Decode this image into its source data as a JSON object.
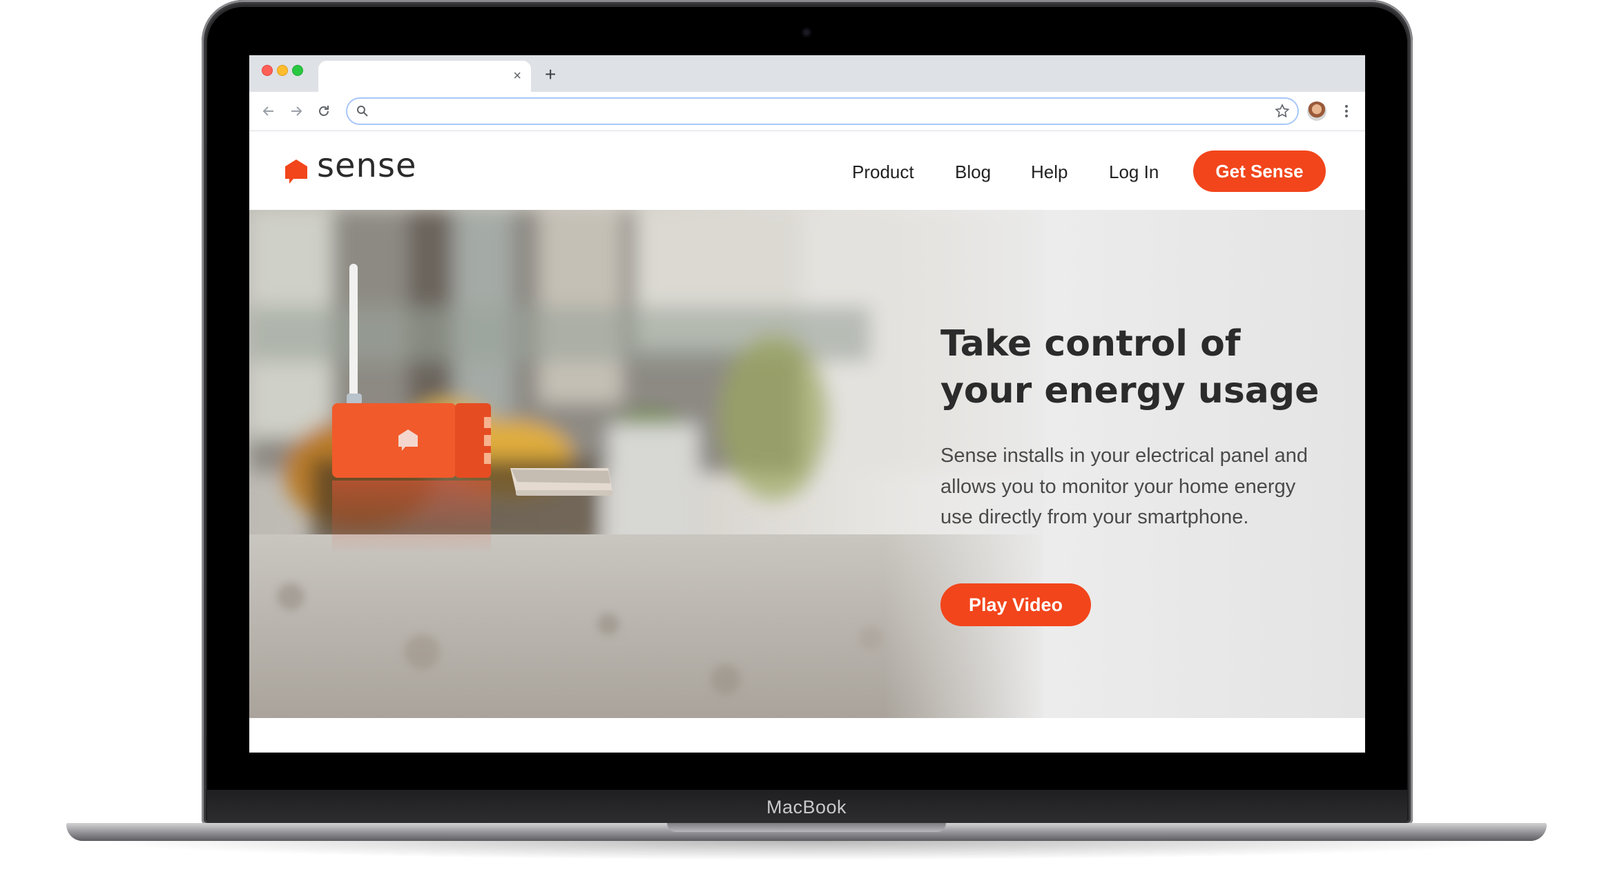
{
  "device": {
    "brand_label": "MacBook"
  },
  "browser": {
    "tab_close_glyph": "×",
    "new_tab_glyph": "+",
    "address_value": "",
    "icons": [
      "back-icon",
      "forward-icon",
      "reload-icon",
      "search-icon",
      "star-icon",
      "profile-avatar",
      "more-menu-icon"
    ]
  },
  "site": {
    "logo_text": "sense",
    "nav": {
      "product": "Product",
      "blog": "Blog",
      "help": "Help",
      "login": "Log In"
    },
    "cta_label": "Get Sense"
  },
  "hero": {
    "title": "Take control of your energy usage",
    "body": "Sense installs in your electrical panel and allows you to monitor your home energy use directly from your smartphone.",
    "button_label": "Play Video"
  },
  "colors": {
    "accent": "#f2451b",
    "text_dark": "#2b2b2b",
    "text_body": "#4a4a4a"
  }
}
